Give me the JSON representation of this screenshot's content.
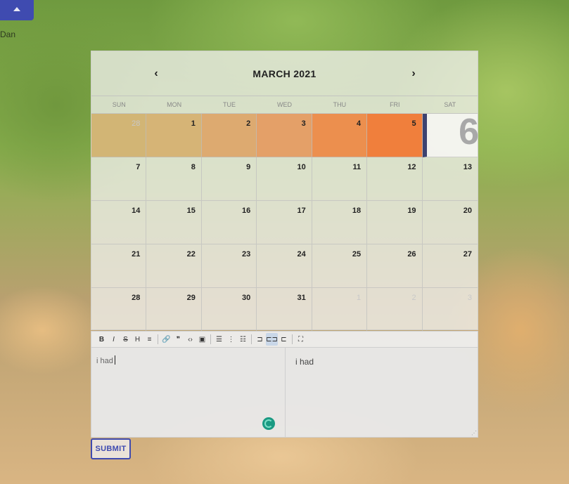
{
  "user": {
    "name": "Dan"
  },
  "calendar": {
    "title": "MARCH 2021",
    "weekdays": [
      "SUN",
      "MON",
      "TUE",
      "WED",
      "THU",
      "FRI",
      "SAT"
    ],
    "days": [
      {
        "label": "28",
        "other": true,
        "color": "#d2b575"
      },
      {
        "label": "1",
        "color": "#d6b476"
      },
      {
        "label": "2",
        "color": "#ddaa70"
      },
      {
        "label": "3",
        "color": "#e4a068"
      },
      {
        "label": "4",
        "color": "#ec8f4e"
      },
      {
        "label": "5",
        "color": "#f07f3c"
      },
      {
        "label": "6",
        "today": true
      },
      {
        "label": "7"
      },
      {
        "label": "8"
      },
      {
        "label": "9"
      },
      {
        "label": "10"
      },
      {
        "label": "11"
      },
      {
        "label": "12"
      },
      {
        "label": "13"
      },
      {
        "label": "14"
      },
      {
        "label": "15"
      },
      {
        "label": "16"
      },
      {
        "label": "17"
      },
      {
        "label": "18"
      },
      {
        "label": "19"
      },
      {
        "label": "20"
      },
      {
        "label": "21"
      },
      {
        "label": "22"
      },
      {
        "label": "23"
      },
      {
        "label": "24"
      },
      {
        "label": "25"
      },
      {
        "label": "26"
      },
      {
        "label": "27"
      },
      {
        "label": "28"
      },
      {
        "label": "29"
      },
      {
        "label": "30"
      },
      {
        "label": "31"
      },
      {
        "label": "1",
        "other": true
      },
      {
        "label": "2",
        "other": true
      },
      {
        "label": "3",
        "other": true
      }
    ]
  },
  "toolbar": {
    "buttons": [
      {
        "glyph": "B",
        "name": "bold",
        "style": "bold"
      },
      {
        "glyph": "I",
        "name": "italic",
        "style": "italic"
      },
      {
        "glyph": "S",
        "name": "strikethrough",
        "style": "strike"
      },
      {
        "glyph": "H",
        "name": "heading"
      },
      {
        "glyph": "≡",
        "name": "paragraph"
      },
      {
        "sep": true
      },
      {
        "glyph": "🔗",
        "name": "link"
      },
      {
        "glyph": "❞",
        "name": "quote"
      },
      {
        "glyph": "‹›",
        "name": "code"
      },
      {
        "glyph": "▣",
        "name": "image"
      },
      {
        "sep": true
      },
      {
        "glyph": "☰",
        "name": "bullet-list"
      },
      {
        "glyph": "⋮",
        "name": "numbered-list"
      },
      {
        "glyph": "☷",
        "name": "checklist"
      },
      {
        "sep": true
      },
      {
        "glyph": "⊐",
        "name": "edit-mode"
      },
      {
        "glyph": "⊏⊐",
        "name": "side-by-side",
        "active": true
      },
      {
        "glyph": "⊏",
        "name": "preview-mode"
      },
      {
        "sep": true
      },
      {
        "glyph": "⛶",
        "name": "fullscreen"
      }
    ]
  },
  "editor": {
    "input_text": "i had",
    "preview_text": "i had"
  },
  "submit_label": "SUBMIT"
}
